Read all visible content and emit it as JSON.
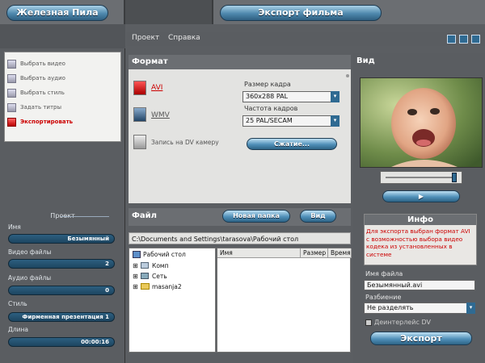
{
  "app": {
    "title": "Железная Пила",
    "section_title": "Экспорт фильма"
  },
  "menu": {
    "items": [
      "Проект",
      "Справка"
    ]
  },
  "tasks": [
    {
      "label": "Выбрать видео",
      "icon": "film-icon",
      "active": false
    },
    {
      "label": "Выбрать аудио",
      "icon": "music-icon",
      "active": false
    },
    {
      "label": "Выбрать стиль",
      "icon": "scissors-icon",
      "active": false
    },
    {
      "label": "Задать титры",
      "icon": "text-icon",
      "active": false
    },
    {
      "label": "Экспортировать",
      "icon": "export-icon",
      "active": true
    }
  ],
  "project": {
    "title": "Проект",
    "name_label": "Имя",
    "name_value": "Безымянный",
    "video_label": "Видео файлы",
    "video_value": "2",
    "audio_label": "Аудио файлы",
    "audio_value": "0",
    "style_label": "Стиль",
    "style_value": "Фирменная презентация 1",
    "length_label": "Длина",
    "length_value": "00:00:16"
  },
  "format": {
    "title": "Формат",
    "options": [
      {
        "label": "AVI",
        "icon": "avi-icon",
        "selected": true
      },
      {
        "label": "WMV",
        "icon": "wmv-icon",
        "selected": false
      },
      {
        "label": "Запись на DV камеру",
        "icon": "camera-icon",
        "selected": false
      }
    ],
    "frame_size_label": "Размер кадра",
    "frame_size_value": "360x288 PAL",
    "frame_rate_label": "Частота кадров",
    "frame_rate_value": "25 PAL/SECAM",
    "compress_button": "Сжатие..."
  },
  "file": {
    "title": "Файл",
    "new_folder_button": "Новая папка",
    "view_button": "Вид",
    "path": "C:\\Documents and Settings\\tarasova\\Рабочий стол",
    "tree": [
      "Рабочий стол",
      "Комп",
      "Сеть",
      "masanja2"
    ],
    "columns": [
      "Имя",
      "Размер",
      "Время"
    ]
  },
  "preview": {
    "title": "Вид"
  },
  "info": {
    "title": "Инфо",
    "text": "Для экспорта выбран формат AVI с возможностью выбора видео кодека из установленных в системе"
  },
  "output": {
    "filename_label": "Имя файла",
    "filename_value": "Безымянный.avi",
    "split_label": "Разбиение",
    "split_value": "Не разделять",
    "deinterlace_label": "Деинтерлейс DV",
    "export_button": "Экспорт"
  },
  "colors": {
    "accent": "#2f6a92",
    "active_task": "#cc0000",
    "info_text": "#cc0000"
  }
}
